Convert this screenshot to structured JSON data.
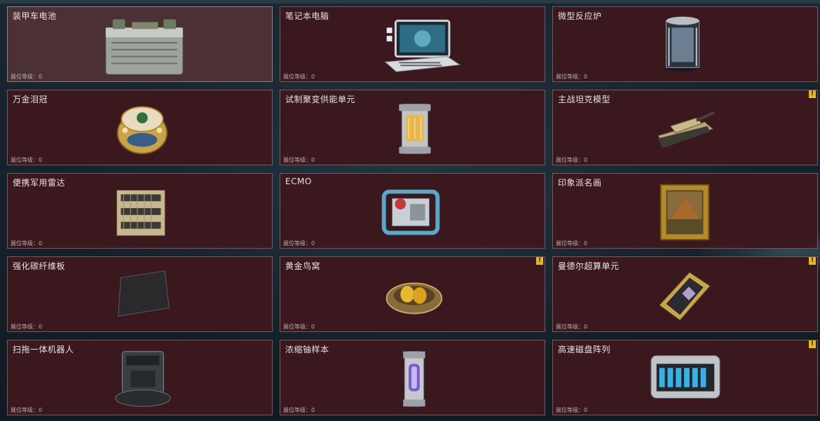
{
  "level_label": "展位等级：",
  "alert_glyph": "!",
  "items": [
    {
      "name": "装甲车电池",
      "level": "0",
      "alert": false,
      "selected": true,
      "icon": "armored-battery-icon"
    },
    {
      "name": "笔记本电脑",
      "level": "0",
      "alert": false,
      "selected": false,
      "icon": "laptop-icon"
    },
    {
      "name": "微型反应炉",
      "level": "0",
      "alert": false,
      "selected": false,
      "icon": "micro-reactor-icon"
    },
    {
      "name": "万金泪冠",
      "level": "0",
      "alert": false,
      "selected": false,
      "icon": "jeweled-egg-icon"
    },
    {
      "name": "试制聚变供能单元",
      "level": "0",
      "alert": false,
      "selected": false,
      "icon": "fusion-cell-icon"
    },
    {
      "name": "主战坦克模型",
      "level": "0",
      "alert": true,
      "selected": false,
      "icon": "tank-model-icon"
    },
    {
      "name": "便携军用雷达",
      "level": "0",
      "alert": false,
      "selected": false,
      "icon": "military-radar-icon"
    },
    {
      "name": "ECMO",
      "level": "0",
      "alert": false,
      "selected": false,
      "icon": "ecmo-machine-icon"
    },
    {
      "name": "印象派名画",
      "level": "0",
      "alert": false,
      "selected": false,
      "icon": "framed-painting-icon"
    },
    {
      "name": "强化碳纤维板",
      "level": "0",
      "alert": false,
      "selected": false,
      "icon": "carbon-plate-icon"
    },
    {
      "name": "黄金鸟窝",
      "level": "0",
      "alert": true,
      "selected": false,
      "icon": "golden-nest-icon"
    },
    {
      "name": "曼德尔超算单元",
      "level": "0",
      "alert": true,
      "selected": false,
      "icon": "supercomputer-unit-icon"
    },
    {
      "name": "扫拖一体机器人",
      "level": "0",
      "alert": false,
      "selected": false,
      "icon": "robot-vacuum-icon"
    },
    {
      "name": "浓缩铀样本",
      "level": "0",
      "alert": false,
      "selected": false,
      "icon": "uranium-canister-icon"
    },
    {
      "name": "高速磁盘阵列",
      "level": "0",
      "alert": true,
      "selected": false,
      "icon": "disk-array-icon"
    }
  ]
}
